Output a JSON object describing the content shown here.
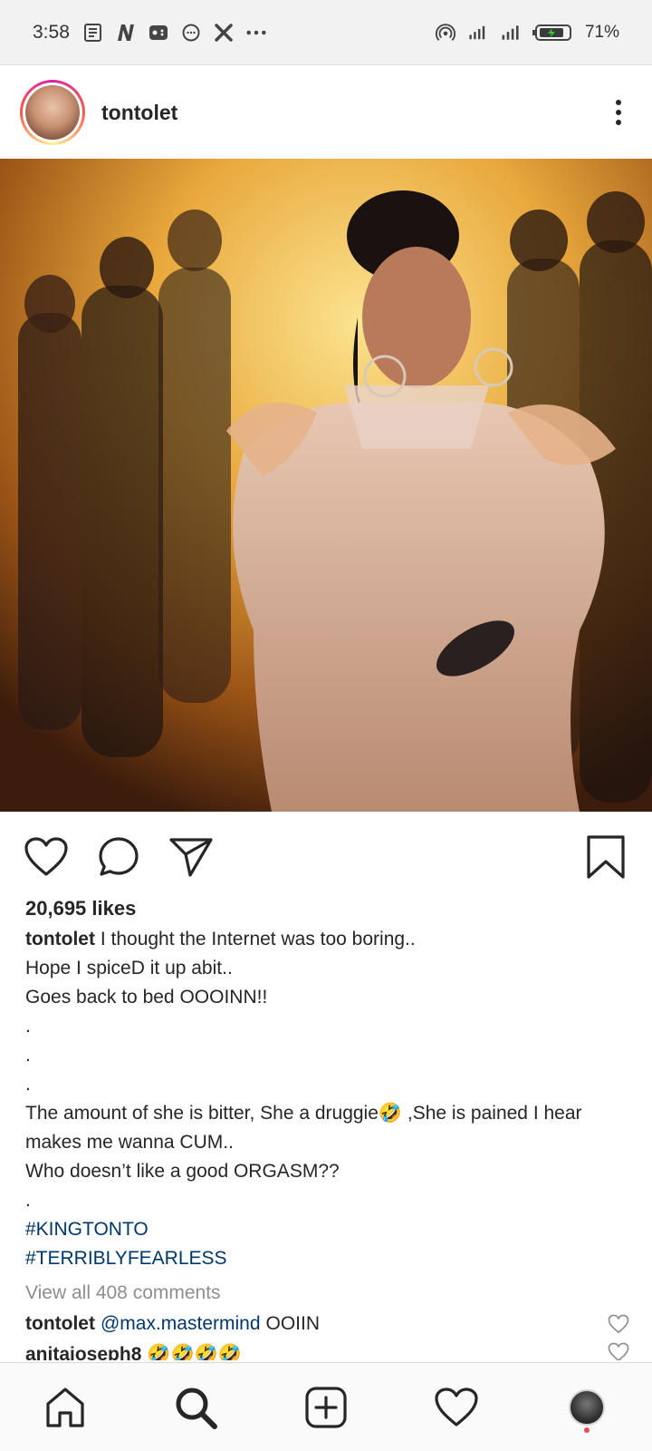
{
  "status_bar": {
    "time": "3:58",
    "battery_percent": "71%",
    "left_icons": [
      "news-icon",
      "n-app-icon",
      "game-icon",
      "chat-bubble-icon",
      "x-icon",
      "more-dots-icon"
    ],
    "right_icons": [
      "hotspot-icon",
      "signal-icon",
      "signal-icon",
      "battery-icon"
    ]
  },
  "post": {
    "username": "tontolet",
    "likes": "20,695 likes",
    "caption_user": "tontolet",
    "caption_lines": [
      "I thought the Internet was too boring..",
      "Hope I spiceD it up abit..",
      "Goes back to bed OOOINN!!",
      ".",
      ".",
      ".",
      "The amount of she is bitter, She a druggie🤣 ,She is pained I hear makes me wanna CUM..",
      "Who doesn’t like a good ORGASM??",
      "."
    ],
    "hashtags": [
      "#KINGTONTO",
      "#TERRIBLYFEARLESS"
    ],
    "view_all_comments": "View all 408 comments",
    "comments": [
      {
        "user": "tontolet",
        "mention": "@max.mastermind",
        "text": "OOIIN"
      },
      {
        "user": "anitajoseph8",
        "mention": "",
        "text": "🤣🤣🤣🤣"
      }
    ]
  },
  "colors": {
    "hashtag": "#00376b",
    "muted": "#8e8e8e",
    "notification_dot": "#ed4956"
  },
  "bottom_nav": [
    "home-icon",
    "search-icon",
    "add-post-icon",
    "activity-heart-icon",
    "profile-avatar"
  ]
}
